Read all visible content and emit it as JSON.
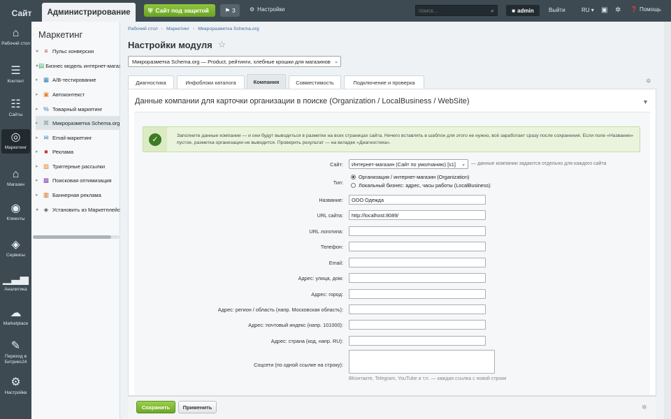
{
  "topbar": {
    "site_tab": "Сайт",
    "admin_tab": "Администрирование",
    "protect_label": "Сайт под защитой",
    "notif_count": "3",
    "settings_label": "Настройки",
    "search_placeholder": "поиск...",
    "user": "admin",
    "logout": "Выйти",
    "lang": "RU",
    "help": "Помощь"
  },
  "leftnav": [
    {
      "label": "Рабочий стол",
      "icon": "home-icon"
    },
    {
      "label": "Контент",
      "icon": "document-icon"
    },
    {
      "label": "Сайты",
      "icon": "calendar-24-icon"
    },
    {
      "label": "Маркетинг",
      "icon": "target-icon"
    },
    {
      "label": "Магазин",
      "icon": "basket-icon"
    },
    {
      "label": "Клиенты",
      "icon": "clients-24-icon"
    },
    {
      "label": "Сервисы",
      "icon": "layers-icon"
    },
    {
      "label": "Аналитика",
      "icon": "bar-chart-icon"
    },
    {
      "label": "Marketplace",
      "icon": "cloud-download-icon"
    },
    {
      "label": "Переход в Битрикс24",
      "icon": "bitrix24-icon"
    },
    {
      "label": "Настройки",
      "icon": "gear-icon"
    }
  ],
  "sidebar": {
    "title": "Маркетинг",
    "items": [
      {
        "label": "Пульс конверсии",
        "icon": "pulse-icon"
      },
      {
        "label": "Бизнес модель интернет-магазина",
        "icon": "business-icon"
      },
      {
        "label": "A/B-тестирование",
        "icon": "ab-test-icon"
      },
      {
        "label": "Автоконтекст",
        "icon": "context-icon"
      },
      {
        "label": "Товарный маркетинг",
        "icon": "percent-icon"
      },
      {
        "label": "Микроразметка Schema.org",
        "icon": "markup-icon"
      },
      {
        "label": "Email-маркетинг",
        "icon": "email-icon"
      },
      {
        "label": "Реклама",
        "icon": "ads-icon"
      },
      {
        "label": "Триггерные рассылки",
        "icon": "trigger-icon"
      },
      {
        "label": "Поисковая оптимизация",
        "icon": "seo-icon"
      },
      {
        "label": "Баннерная реклама",
        "icon": "banner-icon"
      },
      {
        "label": "Установить из Маркетплейс",
        "icon": "install-icon"
      }
    ]
  },
  "breadcrumbs": [
    "Рабочий стол",
    "Маркетинг",
    "Микроразметка Schema.org"
  ],
  "page_title": "Настройки модуля",
  "module_select": "Микроразметка Schema.org — Product, рейтинги, хлебные крошки для магазинов",
  "tabs": [
    "Диагностика",
    "Инфоблоки каталога",
    "Компания",
    "Совместимость",
    "Подключение и проверка"
  ],
  "section_title": "Данные компании для карточки организации в поиске (Organization / LocalBusiness / WebSite)",
  "notice": "Заполните данные компании — и они будут выводиться в разметке на всех страницах сайта. Ничего вставлять в шаблон для этого не нужно, всё заработает сразу после сохранения. Если поле «Название» пустое, разметка организации не выводится. Проверить результат — на вкладке «Диагностика».",
  "form": {
    "site_label": "Сайт:",
    "site_value": "Интернет-магазин (Сайт по умолчанию) [s1]",
    "site_hint": "— данные компании задаются отдельно для каждого сайта",
    "type_label": "Тип:",
    "type_options": [
      "Организация / интернет-магазин (Organization)",
      "Локальный бизнес: адрес, часы работы (LocalBusiness)"
    ],
    "fields": [
      {
        "label": "Название:",
        "value": "ООО Одежда"
      },
      {
        "label": "URL сайта:",
        "value": "http://localhost:8089/"
      },
      {
        "label": "URL логотипа:",
        "value": ""
      },
      {
        "label": "Телефон:",
        "value": ""
      },
      {
        "label": "Email:",
        "value": ""
      },
      {
        "label": "Адрес: улица, дом:",
        "value": ""
      },
      {
        "label": "Адрес: город:",
        "value": ""
      },
      {
        "label": "Адрес: регион / область (напр. Московская область):",
        "value": ""
      },
      {
        "label": "Адрес: почтовый индекс (напр. 101000):",
        "value": ""
      },
      {
        "label": "Адрес: страна (код, напр. RU):",
        "value": ""
      }
    ],
    "social_label": "Соцсети (по одной ссылке на строку):",
    "social_hint": "ВКонтакте, Telegram, YouTube и т.п. — каждая ссылка с новой строки"
  },
  "footer": {
    "save": "Сохранить",
    "apply": "Применить"
  }
}
